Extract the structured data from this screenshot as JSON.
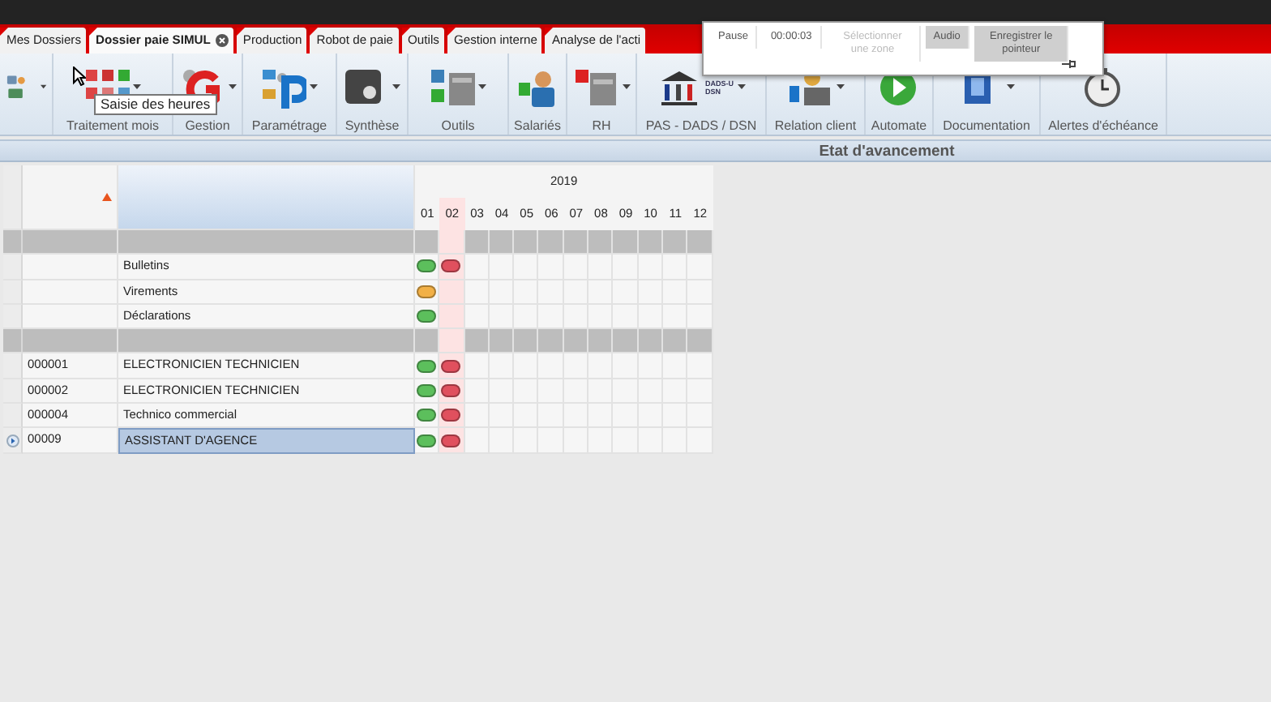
{
  "tabs": [
    {
      "label": "Mes Dossiers",
      "selected": false,
      "closable": false
    },
    {
      "label": "Dossier paie SIMUL",
      "selected": true,
      "closable": true
    },
    {
      "label": "Production",
      "selected": false,
      "closable": false
    },
    {
      "label": "Robot de paie",
      "selected": false,
      "closable": false
    },
    {
      "label": "Outils",
      "selected": false,
      "closable": false
    },
    {
      "label": "Gestion interne",
      "selected": false,
      "closable": false
    },
    {
      "label": "Analyse de l'acti",
      "selected": false,
      "closable": false
    }
  ],
  "ribbon": {
    "groups": [
      {
        "menu": true
      },
      {
        "label": "Traitement mois",
        "menu": true
      },
      {
        "label": "Gestion",
        "menu": true
      },
      {
        "label": "Paramétrage",
        "menu": true
      },
      {
        "label": "Synthèse",
        "menu": true
      },
      {
        "label": "Outils",
        "menu": true
      },
      {
        "label": "Salariés",
        "menu": false
      },
      {
        "label": "RH",
        "menu": true
      },
      {
        "label": "PAS - DADS / DSN",
        "menu": true,
        "icon_caption": "DADS-U DSN"
      },
      {
        "label": "Relation client",
        "menu": true
      },
      {
        "label": "Automate",
        "menu": false
      },
      {
        "label": "Documentation",
        "menu": true
      },
      {
        "label": "Alertes d'échéance",
        "menu": false
      }
    ],
    "tooltip": "Saisie des heures"
  },
  "recorder": {
    "items": [
      {
        "label": "Pause",
        "disabled": false,
        "on": false
      },
      {
        "label": "00:00:03",
        "disabled": false,
        "on": false
      },
      {
        "label": "Sélectionner une zone",
        "disabled": true,
        "on": false
      },
      {
        "label": "Audio",
        "disabled": false,
        "on": true
      },
      {
        "label": "Enregistrer le pointeur",
        "disabled": false,
        "on": true
      }
    ]
  },
  "panel_title": "Etat d'avancement",
  "grid": {
    "year": "2019",
    "months": [
      {
        "label": "01",
        "selected": false
      },
      {
        "label": "02",
        "selected": true
      },
      {
        "label": "03",
        "selected": false
      },
      {
        "label": "04",
        "selected": false
      },
      {
        "label": "05",
        "selected": false
      },
      {
        "label": "06",
        "selected": false
      },
      {
        "label": "07",
        "selected": false
      },
      {
        "label": "08",
        "selected": false
      },
      {
        "label": "09",
        "selected": false
      },
      {
        "label": "10",
        "selected": false
      },
      {
        "label": "11",
        "selected": false
      },
      {
        "label": "12",
        "selected": false
      }
    ],
    "rows": [
      {
        "kind": "band",
        "selected": false
      },
      {
        "kind": "item",
        "name": "Bulletins",
        "selected": false,
        "statuses": [
          {
            "color": "#5cbf5c"
          },
          {
            "color": "#e0505e"
          }
        ]
      },
      {
        "kind": "item",
        "name": "Virements",
        "selected": false,
        "statuses": [
          {
            "color": "#f2b046"
          }
        ]
      },
      {
        "kind": "item",
        "name": "Déclarations",
        "selected": false,
        "statuses": [
          {
            "color": "#5cbf5c"
          }
        ]
      },
      {
        "kind": "band",
        "selected": false
      },
      {
        "kind": "item",
        "code": "000001",
        "name": "ELECTRONICIEN TECHNICIEN",
        "selected": false,
        "statuses": [
          {
            "color": "#5cbf5c"
          },
          {
            "color": "#e0505e"
          }
        ]
      },
      {
        "kind": "item",
        "code": "000002",
        "name": "ELECTRONICIEN TECHNICIEN",
        "selected": false,
        "statuses": [
          {
            "color": "#5cbf5c"
          },
          {
            "color": "#e0505e"
          }
        ]
      },
      {
        "kind": "item",
        "code": "000004",
        "name": "Technico commercial",
        "selected": false,
        "statuses": [
          {
            "color": "#5cbf5c"
          },
          {
            "color": "#e0505e"
          }
        ]
      },
      {
        "kind": "item",
        "code": "00009",
        "name": "ASSISTANT D'AGENCE",
        "selected": true,
        "statuses": [
          {
            "color": "#5cbf5c"
          },
          {
            "color": "#e0505e"
          }
        ]
      }
    ]
  }
}
